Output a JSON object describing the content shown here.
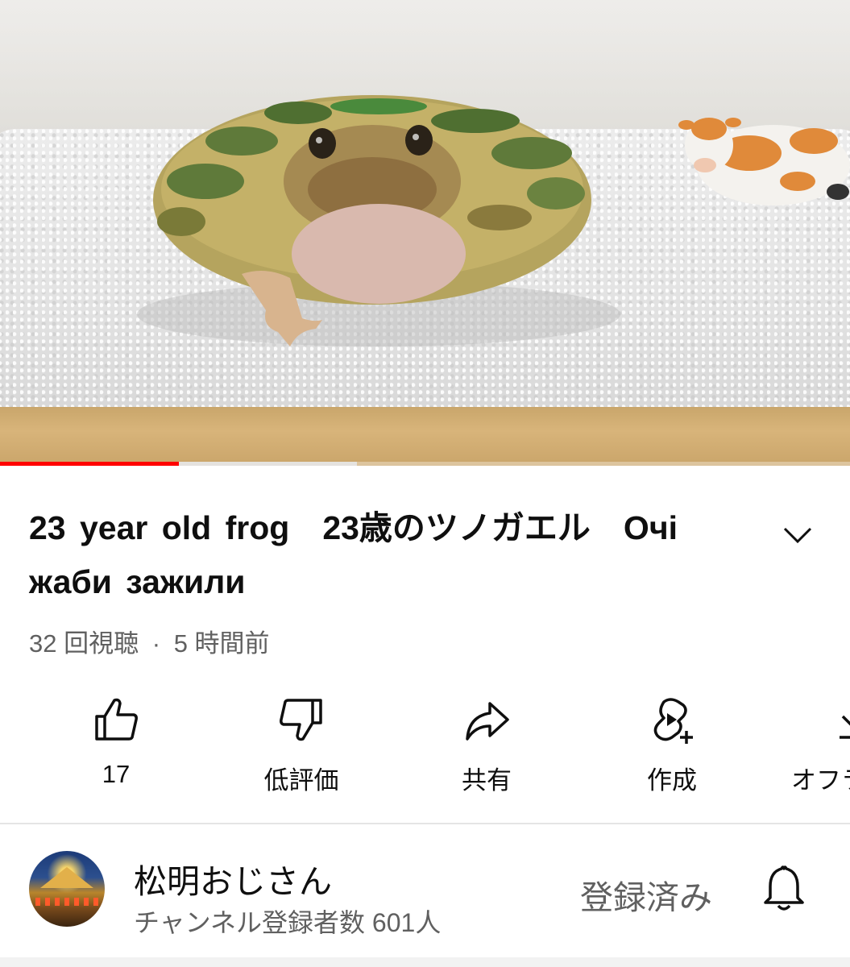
{
  "video": {
    "progress_played": 0.21,
    "progress_buffered": 0.42
  },
  "title": "23 year old frog　23歳のツノガエル　Очі жаби зажили",
  "meta": {
    "views": "32 回視聴",
    "separator": "·",
    "age": "5 時間前"
  },
  "actions": [
    {
      "label": "17",
      "icon": "thumbs-up-icon"
    },
    {
      "label": "低評価",
      "icon": "thumbs-down-icon"
    },
    {
      "label": "共有",
      "icon": "share-icon"
    },
    {
      "label": "作成",
      "icon": "create-icon"
    },
    {
      "label": "オフラ",
      "icon": "download-icon"
    }
  ],
  "channel": {
    "name": "松明おじさん",
    "subscribers": "チャンネル登録者数 601人",
    "subscribe_label": "登録済み"
  },
  "colors": {
    "accent": "#ff0000",
    "text_primary": "#0f0f0f",
    "text_secondary": "#606060"
  }
}
